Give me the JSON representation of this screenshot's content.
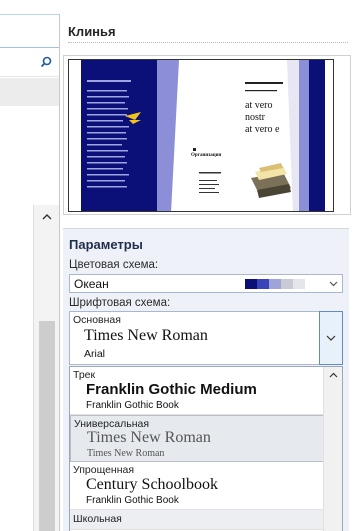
{
  "pane": {
    "title": "Клинья"
  },
  "params": {
    "title": "Параметры",
    "color_label": "Цветовая схема:",
    "font_label": "Шрифтовая схема:",
    "color_scheme": {
      "value": "Океан",
      "swatches": [
        "#0a1078",
        "#3a44b8",
        "#9ea4d8",
        "#c8cad6",
        "#e4e6ec"
      ]
    },
    "font_scheme": {
      "category": "Основная",
      "heading_font": "Times New Roman",
      "body_font": "Arial"
    }
  },
  "preview": {
    "text_line_1": "at vero",
    "text_line_2": "nostr",
    "text_line_3": "at vero e",
    "org_label": "Организация"
  },
  "font_list": [
    {
      "category": "Трек",
      "heading": "Franklin Gothic Medium",
      "body": "Franklin Gothic Book"
    },
    {
      "category": "Универсальная",
      "heading": "Times New Roman",
      "body": "Times New Roman"
    },
    {
      "category": "Упрощенная",
      "heading": "Century Schoolbook",
      "body": "Franklin Gothic Book"
    },
    {
      "category": "Школьная",
      "heading": "",
      "body": ""
    }
  ],
  "colors": {
    "brochure_navy": "#0a1078",
    "brochure_lavender": "#8c8fd8",
    "accent_yellow": "#f2c21b"
  }
}
